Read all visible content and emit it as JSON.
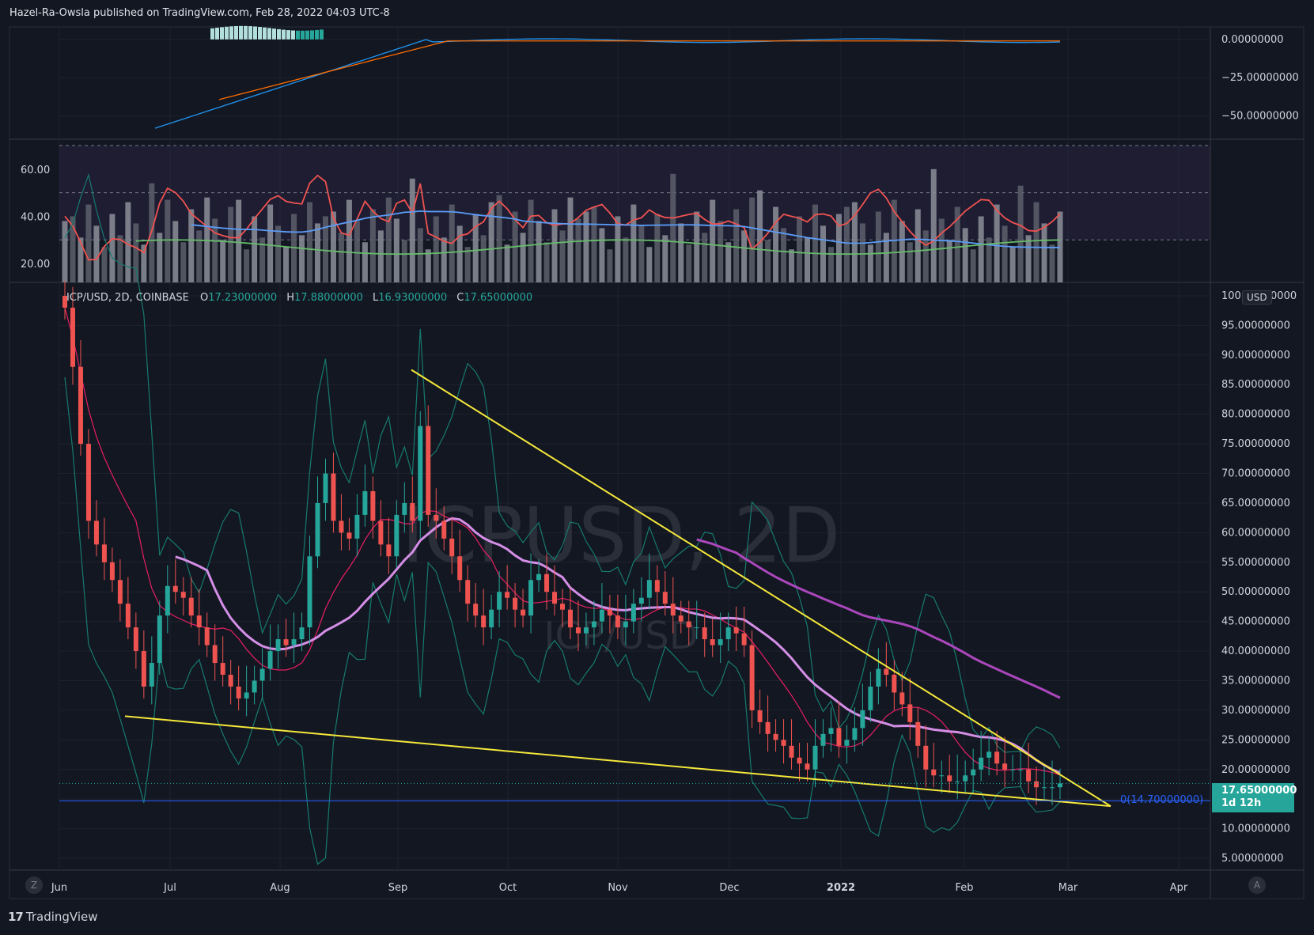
{
  "header": {
    "text": "Hazel-Ra-Owsla published on TradingView.com, Feb 28, 2022 04:03 UTC-8"
  },
  "legend": {
    "symbol": "ICP/USD, 2D, COINBASE",
    "open_label": "O",
    "open": "17.23000000",
    "high_label": "H",
    "high": "17.88000000",
    "low_label": "L",
    "low": "16.93000000",
    "close_label": "C",
    "close": "17.65000000"
  },
  "watermark": {
    "main": "ICPUSD, 2D",
    "sub": "ICP/USD"
  },
  "currency": "USD",
  "last_price": {
    "price": "17.65000000",
    "countdown": "1d 12h"
  },
  "fib_label": "0(14.70000000)",
  "footer": {
    "brand": "TradingView"
  },
  "buttons": {
    "left": "Z",
    "right": "A"
  },
  "colors": {
    "background": "#131722",
    "up": "#26a69a",
    "down": "#ef5350",
    "trendline": "#f5e83a",
    "ma_pink": "#d48ee6",
    "ma_purple": "#ab47bc",
    "bb_basis": "#e91e63",
    "bb_band": "#167a6e",
    "macd": "#2196f3",
    "signal": "#ff6d00"
  },
  "chart_data": [
    {
      "type": "line",
      "panel": "macd",
      "yticks": [
        "0.00000000",
        "−25.00000000",
        "−50.00000000"
      ],
      "ylim": [
        -60,
        3
      ],
      "series": []
    },
    {
      "type": "bar",
      "panel": "volume-rsi",
      "yticks": [
        "60.00",
        "40.00",
        "20.00"
      ],
      "ylim": [
        12,
        72
      ],
      "series": []
    },
    {
      "type": "candlestick",
      "panel": "price",
      "xticks": [
        "Jun",
        "Jul",
        "Aug",
        "Sep",
        "Oct",
        "Nov",
        "Dec",
        "2022",
        "Feb",
        "Mar",
        "Apr"
      ],
      "yticks": [
        "100.00000000",
        "95.00000000",
        "90.00000000",
        "85.00000000",
        "80.00000000",
        "75.00000000",
        "70.00000000",
        "65.00000000",
        "60.00000000",
        "55.00000000",
        "50.00000000",
        "45.00000000",
        "40.00000000",
        "35.00000000",
        "30.00000000",
        "25.00000000",
        "20.00000000",
        "15.00000000",
        "10.00000000",
        "5.00000000"
      ],
      "ylim": [
        3,
        102
      ],
      "close": [
        98,
        88,
        75,
        62,
        58,
        55,
        52,
        48,
        44,
        40,
        34,
        38,
        46,
        51,
        50,
        49,
        46,
        44,
        41,
        38,
        36,
        34,
        32,
        33,
        35,
        37,
        40,
        42,
        41,
        42,
        44,
        56,
        65,
        70,
        62,
        60,
        59,
        63,
        67,
        62,
        58,
        56,
        63,
        65,
        62,
        78,
        63,
        62,
        59,
        56,
        52,
        48,
        46,
        44,
        47,
        50,
        49,
        47,
        46,
        52,
        53,
        50,
        48,
        47,
        44,
        43,
        44,
        45,
        47,
        46,
        44,
        45,
        48,
        49,
        52,
        50,
        48,
        46,
        45,
        44,
        44,
        42,
        41,
        42,
        44,
        43,
        41,
        30,
        28,
        26,
        25,
        24,
        22,
        21,
        20,
        24,
        26,
        27,
        24,
        25,
        27,
        30,
        34,
        37,
        36,
        33,
        31,
        28,
        24,
        20,
        19,
        19,
        18,
        18,
        19,
        20,
        22,
        23,
        21,
        20,
        20,
        20,
        18,
        17,
        17,
        17,
        17.65
      ]
    }
  ]
}
